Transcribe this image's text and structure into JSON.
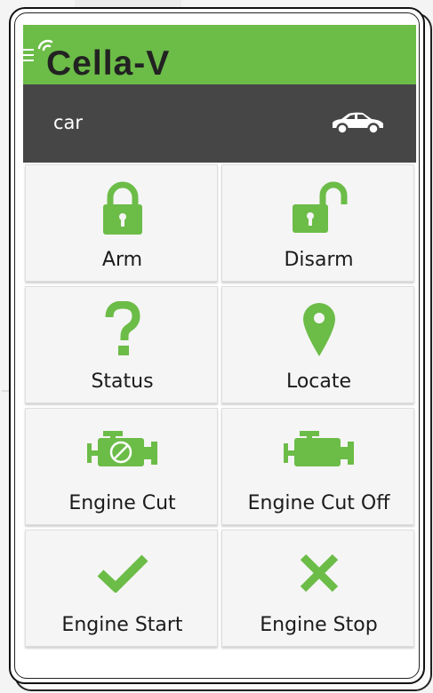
{
  "app": {
    "brand": "Cella-V",
    "accent_color": "#6cbc48",
    "header_color": "#464646"
  },
  "device": {
    "name": "car",
    "icon": "car-icon"
  },
  "actions": [
    {
      "label": "Arm",
      "icon": "locked-padlock-icon"
    },
    {
      "label": "Disarm",
      "icon": "unlocked-padlock-icon"
    },
    {
      "label": "Status",
      "icon": "question-mark-icon"
    },
    {
      "label": "Locate",
      "icon": "map-pin-icon"
    },
    {
      "label": "Engine Cut",
      "icon": "engine-cut-icon"
    },
    {
      "label": "Engine Cut Off",
      "icon": "engine-icon"
    },
    {
      "label": "Engine Start",
      "icon": "checkmark-icon"
    },
    {
      "label": "Engine Stop",
      "icon": "x-mark-icon"
    }
  ]
}
